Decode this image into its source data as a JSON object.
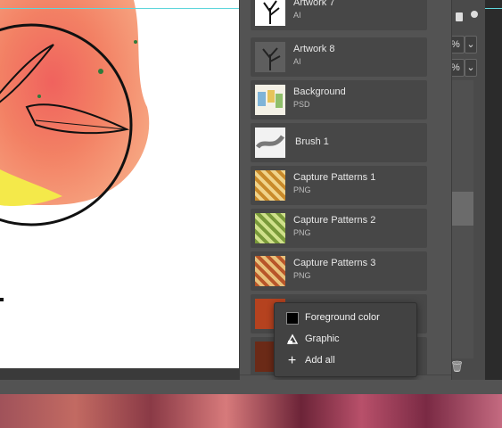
{
  "library": {
    "items": [
      {
        "name": "Artwork 7",
        "type": "AI"
      },
      {
        "name": "Artwork 8",
        "type": "AI"
      },
      {
        "name": "Background",
        "type": "PSD"
      },
      {
        "name": "Brush 1",
        "type": ""
      },
      {
        "name": "Capture Patterns 1",
        "type": "PNG"
      },
      {
        "name": "Capture Patterns 2",
        "type": "PNG"
      },
      {
        "name": "Capture Patterns 3",
        "type": "PNG"
      }
    ],
    "swatches": [
      {
        "color": "#b5421f"
      },
      {
        "color": "#6b2a17"
      }
    ]
  },
  "add_menu": {
    "items": [
      {
        "label": "Foreground color",
        "icon": "foreground-color-icon"
      },
      {
        "label": "Graphic",
        "icon": "graphic-icon"
      },
      {
        "label": "Add all",
        "icon": "add-icon"
      }
    ]
  },
  "back_panel": {
    "pct1": "%",
    "pct2": "%"
  },
  "colors": {
    "guide": "#5fd6dc",
    "panel": "#535353",
    "menu": "#424242"
  }
}
